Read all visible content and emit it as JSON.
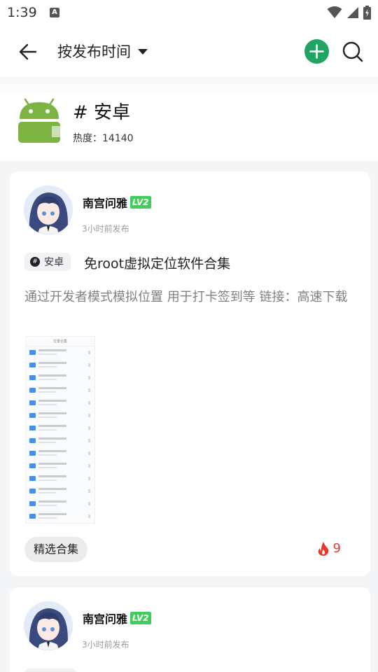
{
  "status_bar": {
    "time": "1:39",
    "notif_icon": "A"
  },
  "app_bar": {
    "sort_label": "按发布时间"
  },
  "topic": {
    "name": "# 安卓",
    "heat": "热度：14140"
  },
  "posts": [
    {
      "author": "南宫问雅",
      "level": "LV2",
      "time": "3小时前发布",
      "tag": "安卓",
      "title": "免root虚拟定位软件合集",
      "body": "通过开发者模式模拟位置 用于打卡签到等 链接：高速下载",
      "thumb_title": "位置合集",
      "collection": "精选合集",
      "hot_count": "9"
    },
    {
      "author": "南宫问雅",
      "level": "LV2",
      "time": "3小时前发布"
    }
  ],
  "colors": {
    "accent_green": "#1fa463",
    "android_green": "#7cb342",
    "hot_red": "#e8382c",
    "level_green": "#3ecf5a"
  }
}
